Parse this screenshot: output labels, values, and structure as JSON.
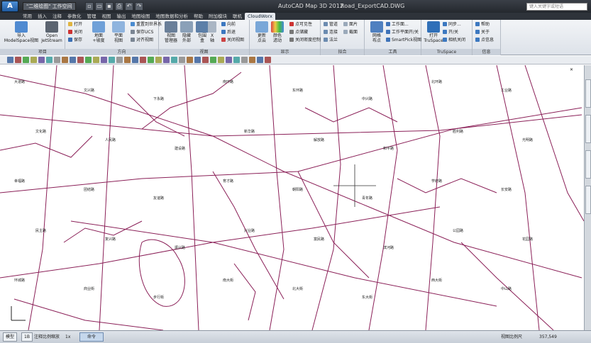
{
  "window": {
    "app_button": "A",
    "workspace": "\"二维绘图\" 工作空间",
    "title": "AutoCAD Map 3D 2012",
    "file": "Road_ExportCAD.DWG",
    "search_placeholder": "键入关键字或短语"
  },
  "ribbon_tabs": [
    "常用",
    "插入",
    "注释",
    "参数化",
    "管理",
    "视图",
    "输出",
    "地图绘图",
    "地图数据和分析",
    "帮助",
    "附加模块",
    "联机",
    "CloudWorx"
  ],
  "active_tab": "CloudWorx",
  "panels": {
    "project": {
      "title": "项目",
      "import": "导入\nModelSpace视图",
      "open": "Open\nJetStream",
      "open_small": "打开",
      "close_small": "关闭",
      "save_small": "保存"
    },
    "direction": {
      "title": "方向",
      "ground": "地面\n+坡度",
      "plane": "平面\n视图",
      "reset_world": "重置到世界系",
      "save_ucs": "保存UCS",
      "align_view": "对齐视图"
    },
    "view": {
      "title": "视图",
      "view_manager": "视图\n管理器",
      "hide_outside": "隐藏\n外部",
      "slice": "包围\n盒",
      "x_slice": "X\n轴",
      "forward": "向前",
      "back": "后退",
      "close_view": "关闭视图"
    },
    "display": {
      "title": "显示",
      "update_cloud": "更新\n点云",
      "color_map": "颜色\n滤动",
      "visible": "点可见性",
      "limit_box": "点储藏",
      "close_density": "关闭密度控制"
    },
    "fit": {
      "title": "拟合",
      "pipe": "管道",
      "connect": "连接",
      "method": "法兰",
      "surface": "面片",
      "section": "截面"
    },
    "tools": {
      "title": "工具",
      "grid": "网格\n布点",
      "work_plane": "工作面...",
      "work_plane_toggle": "工作平面开/关",
      "smartpick": "SmartPick视图"
    },
    "truspace": {
      "title": "TruSpace",
      "open": "打开\nTruSpace",
      "sync": "同步...",
      "on_off": "开/关",
      "camera_off": "相机关闭"
    },
    "info": {
      "title": "信息",
      "help": "帮助",
      "about": "关于",
      "point_info": "点信息"
    }
  },
  "map_labels": [
    "大道路",
    "文兴路",
    "下永路",
    "南环路",
    "东环路",
    "中兴路",
    "北环路",
    "工业路",
    "文化路",
    "人民路",
    "建设路",
    "新华路",
    "解放路",
    "和平路",
    "胜利路",
    "光明路",
    "幸福路",
    "团结路",
    "友谊路",
    "育才路",
    "朝阳路",
    "青年路",
    "学府路",
    "长安路",
    "民主路",
    "复兴路",
    "振兴路",
    "兴业路",
    "富民路",
    "滨河路",
    "公园路",
    "花园路",
    "环城路",
    "商业街",
    "步行街",
    "南大街",
    "北大街",
    "东大街",
    "西大街",
    "中山路"
  ],
  "status_bar": {
    "model_tab": "模型",
    "layout1": "1B",
    "annotation_scale": "注释比例缩放",
    "command_tab": "命令",
    "view_scale": "视图比例尺",
    "scale_value": "357,549",
    "coord_unit": "1x"
  },
  "colors": {
    "road": "#8a1f57",
    "title_bg": "#2b2f35",
    "ribbon_bg": "#e6e9ee",
    "accent": "#1f5aa0"
  }
}
